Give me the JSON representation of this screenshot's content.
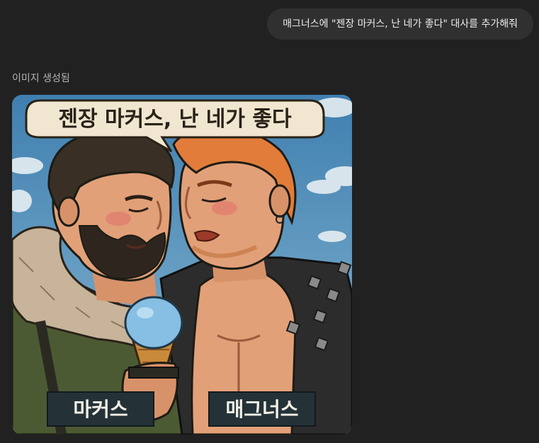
{
  "conversation": {
    "user_message": "매그너스에 \"젠장 마커스, 난 네가 좋다\" 대사를 추가해줘",
    "image_status": "이미지 생성됨"
  },
  "image": {
    "speech_bubble": "젠장 마커스, 난 네가 좋다",
    "left_nameplate": "마커스",
    "right_nameplate": "매그너스"
  }
}
